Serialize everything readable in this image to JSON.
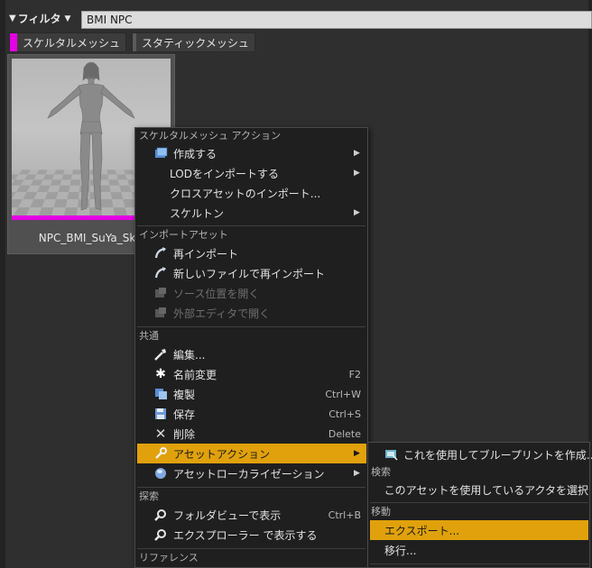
{
  "filter": {
    "button_label": "フィルタ",
    "search_value": "BMI NPC"
  },
  "chips": [
    {
      "label": "スケルタルメッシュ",
      "color": "#e400e4"
    },
    {
      "label": "スタティックメッシュ",
      "color": "#5a5a5a"
    }
  ],
  "asset": {
    "name": "NPC_BMI_SuYa_Skin"
  },
  "menu": {
    "sections": {
      "skeletal_actions": "スケルタルメッシュ アクション",
      "import_asset": "インポートアセット",
      "common": "共通",
      "search": "探索",
      "reference": "リファレンス"
    },
    "items": {
      "create": "作成する",
      "import_lod": "LODをインポートする",
      "import_cloth": "クロスアセットのインポート...",
      "skeleton": "スケルトン",
      "reimport": "再インポート",
      "reimport_new": "新しいファイルで再インポート",
      "open_source": "ソース位置を開く",
      "open_external": "外部エディタで開く",
      "edit": "編集...",
      "rename": "名前変更",
      "duplicate": "複製",
      "save": "保存",
      "delete": "削除",
      "asset_actions": "アセットアクション",
      "asset_localization": "アセットローカライゼーション",
      "show_folder": "フォルダビューで表示",
      "show_explorer": "エクスプローラー で表示する"
    },
    "shortcuts": {
      "rename": "F2",
      "duplicate": "Ctrl+W",
      "save": "Ctrl+S",
      "delete": "Delete",
      "show_folder": "Ctrl+B"
    }
  },
  "submenu": {
    "create_blueprint": "これを使用してブループリントを作成...",
    "sections": {
      "search": "検索",
      "move": "移動"
    },
    "select_actors": "このアセットを使用しているアクタを選択",
    "export": "エクスポート...",
    "migrate": "移行..."
  },
  "colors": {
    "highlight": "#e0a10c",
    "skeletal_mesh": "#e400e4"
  }
}
